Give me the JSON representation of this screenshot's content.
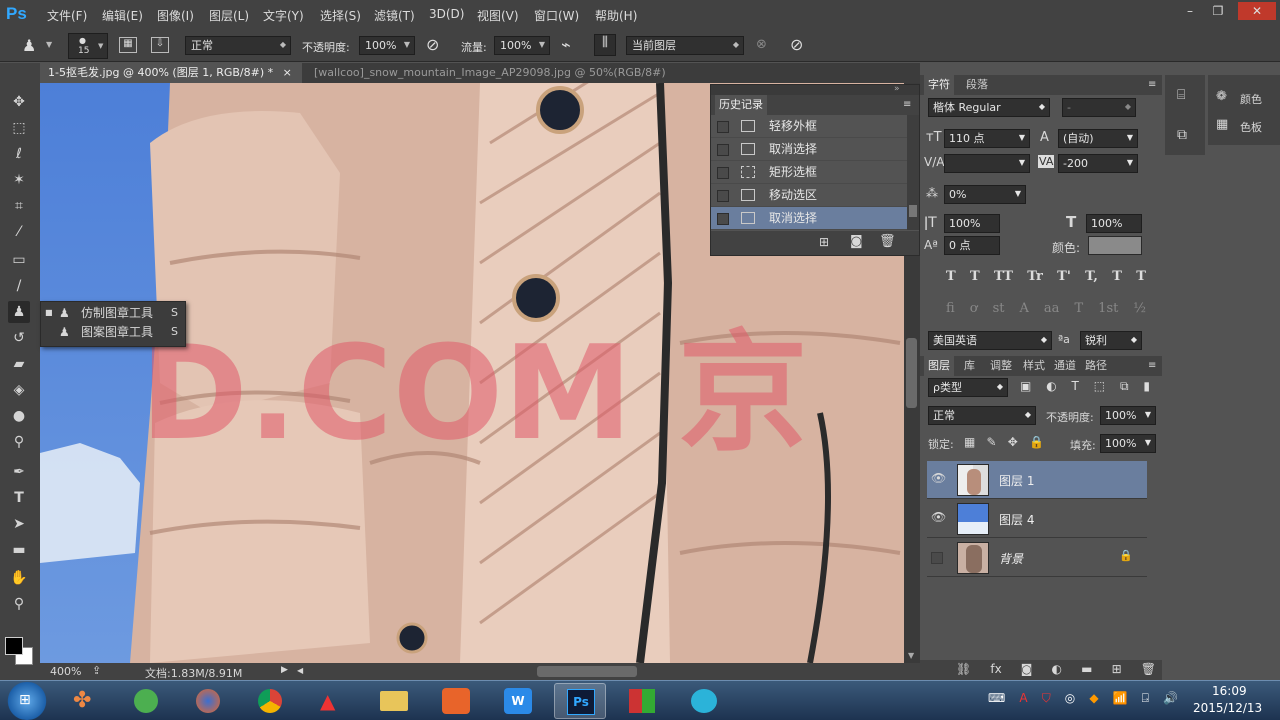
{
  "app": {
    "logo": "Ps"
  },
  "menu": [
    "文件(F)",
    "编辑(E)",
    "图像(I)",
    "图层(L)",
    "文字(Y)",
    "选择(S)",
    "滤镜(T)",
    "3D(D)",
    "视图(V)",
    "窗口(W)",
    "帮助(H)"
  ],
  "window_controls": {
    "minimize": "–",
    "restore": "❐",
    "close": "✕"
  },
  "options": {
    "brush_size": "15",
    "mode": "正常",
    "opacity_label": "不透明度:",
    "opacity": "100%",
    "flow_label": "流量:",
    "flow": "100%",
    "sample": "当前图层"
  },
  "tabs": [
    {
      "label": "1-5抠毛发.jpg @ 400% (图层 1, RGB/8#) *",
      "close": "×"
    },
    {
      "label": "[wallcoo]_snow_mountain_Image_AP29098.jpg @ 50%(RGB/8#)",
      "close": "×"
    }
  ],
  "flyout": {
    "items": [
      {
        "label": "仿制图章工具",
        "key": "S"
      },
      {
        "label": "图案图章工具",
        "key": "S"
      }
    ]
  },
  "history": {
    "title": "历史记录",
    "items": [
      "轻移外框",
      "取消选择",
      "矩形选框",
      "移动选区",
      "取消选择"
    ],
    "selected_index": 4
  },
  "character": {
    "tabs": [
      "字符",
      "段落"
    ],
    "font": "楷体 Regular",
    "style": "-",
    "size": "110 点",
    "leading": "(自动)",
    "tracking": "-200",
    "kerning": "",
    "scale_pct": "0%",
    "v_scale": "100%",
    "h_scale": "100%",
    "baseline": "0 点",
    "color_label": "颜色:",
    "typo_buttons": [
      "T",
      "T",
      "TT",
      "Tr",
      "T'",
      "T,",
      "T",
      "T"
    ],
    "ot_buttons": [
      "fi",
      "ơ",
      "st",
      "A",
      "aa",
      "T",
      "1st",
      "½"
    ],
    "language": "美国英语",
    "aa_label": "ªa",
    "antialias": "锐利"
  },
  "layers": {
    "tabs": [
      "图层",
      "库",
      "调整",
      "样式",
      "通道",
      "路径"
    ],
    "filter": "ρ类型",
    "blend": "正常",
    "opacity_label": "不透明度:",
    "opacity": "100%",
    "lock_label": "锁定:",
    "fill_label": "填充:",
    "fill": "100%",
    "items": [
      {
        "name": "图层 1",
        "visible": true,
        "selected": true
      },
      {
        "name": "图层 4",
        "visible": true,
        "selected": false
      },
      {
        "name": "背景",
        "visible": false,
        "selected": false,
        "locked": true
      }
    ]
  },
  "side_panels": [
    {
      "label": "颜色"
    },
    {
      "label": "色板"
    }
  ],
  "status": {
    "zoom": "400%",
    "doc": "文档:1.83M/8.91M"
  },
  "watermark": "D.COM 京",
  "clock": {
    "time": "16:09",
    "date": "2015/12/13"
  },
  "taskbar": {
    "ps_label": "Ps"
  },
  "colors": {
    "accent": "#31a8ff",
    "selection": "#6a7e9e",
    "watermark": "#e05a6a"
  }
}
